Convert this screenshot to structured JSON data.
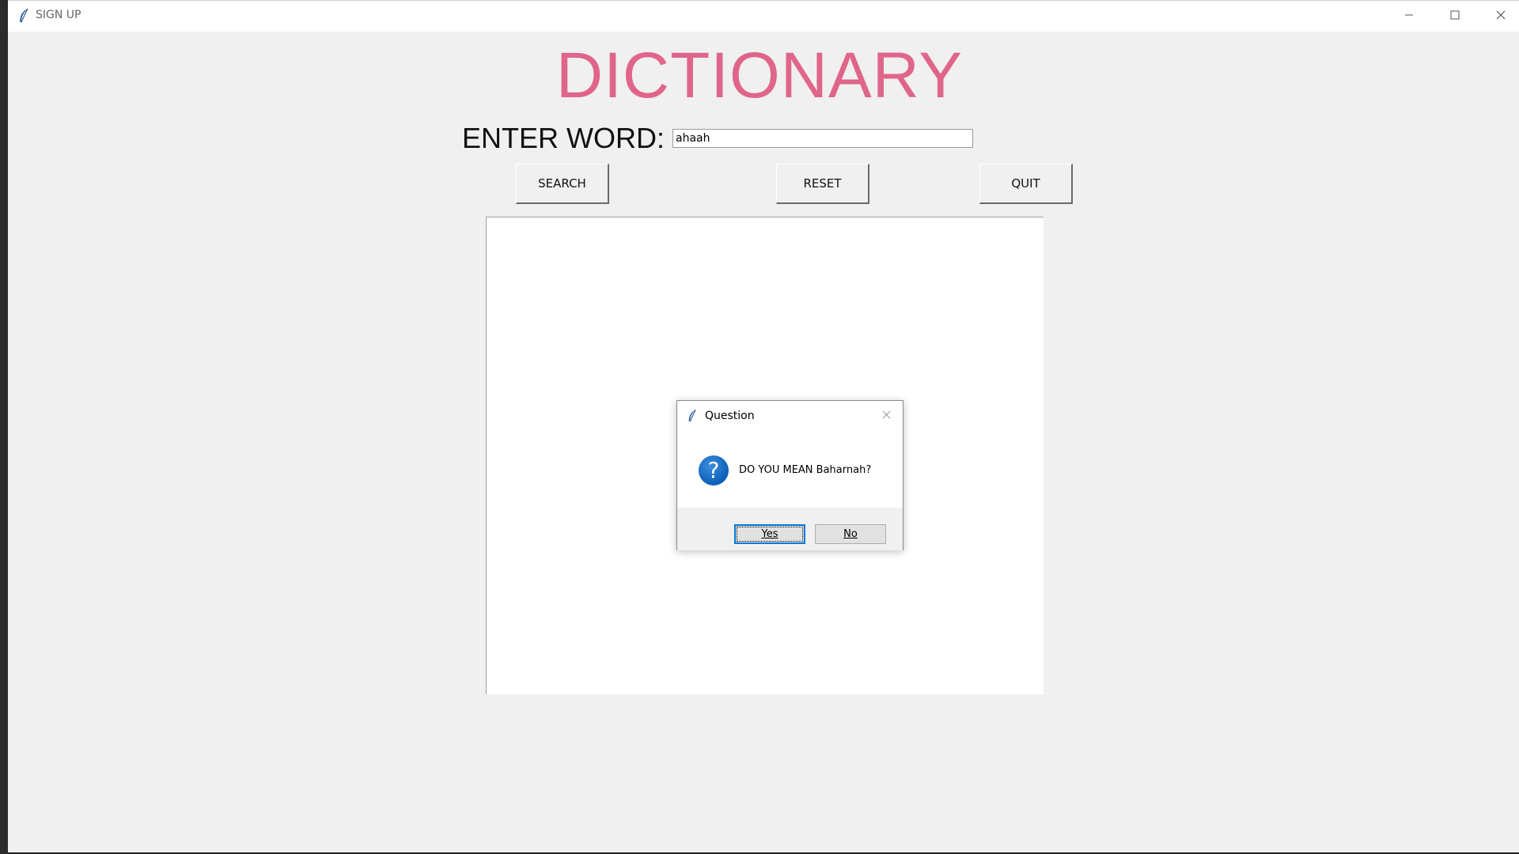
{
  "window": {
    "title": "SIGN UP"
  },
  "app": {
    "heading": "DICTIONARY",
    "enter_label": "ENTER WORD:",
    "word_value": "ahaah",
    "buttons": {
      "search": "SEARCH",
      "reset": "RESET",
      "quit": "QUIT"
    },
    "heading_color": "#e0658a"
  },
  "dialog": {
    "title": "Question",
    "message": "DO YOU MEAN Baharnah?",
    "icon": "question-icon",
    "yes_label": "Yes",
    "no_label": "No",
    "accent_color": "#0078d7"
  },
  "icons": {
    "app": "feather-icon",
    "minimize": "minimize-icon",
    "maximize": "maximize-icon",
    "close": "close-icon"
  }
}
